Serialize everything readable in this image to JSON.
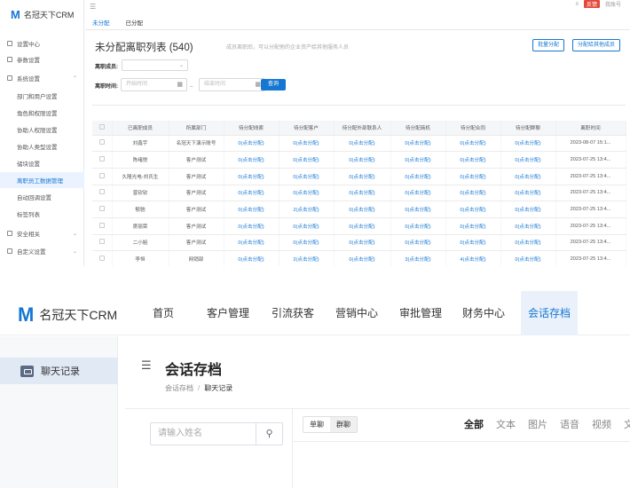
{
  "top": {
    "brand": "名冠天下CRM",
    "sidebar": [
      {
        "label": "设置中心",
        "icon": "settings-icon"
      },
      {
        "label": "参数设置",
        "icon": "params-icon"
      },
      {
        "label": "系统设置",
        "icon": "system-icon"
      },
      {
        "label": "部门和用户设置",
        "sub": true
      },
      {
        "label": "角色和权限设置",
        "sub": true
      },
      {
        "label": "协助人权限设置",
        "sub": true
      },
      {
        "label": "协助人类型设置",
        "sub": true
      },
      {
        "label": "储块设置",
        "sub": true
      },
      {
        "label": "离职员工数据管理",
        "sub": true,
        "active": true
      },
      {
        "label": "自动回调设置",
        "sub": true
      },
      {
        "label": "标签列表",
        "sub": true
      },
      {
        "label": "安全相关",
        "icon": "lock-icon"
      },
      {
        "label": "自定义设置",
        "icon": "custom-icon"
      }
    ],
    "header_badge": "反馈",
    "header_user": "我账号",
    "tabs": [
      "未分配",
      "已分配"
    ],
    "page_title": "未分配离职列表 (540)",
    "page_note": "成员离职后，可以分配他的企业资产给其他服务人员",
    "buttons": [
      "批量分配",
      "分配给其他成员"
    ],
    "filter_member_label": "离职成员:",
    "filter_time_label": "离职时间:",
    "date_start_placeholder": "开始时间",
    "date_end_placeholder": "结束时间",
    "date_separator": "_",
    "query_button": "查询",
    "columns": [
      "已离职成员",
      "所属部门",
      "待分配线索",
      "待分配客户",
      "待分配外部联系人",
      "待分配商机",
      "待分配合同",
      "待分配群聊",
      "离职时间"
    ],
    "rows": [
      [
        "刘鑫宇",
        "名冠天下演示账号",
        "0(点击分配)",
        "0(点击分配)",
        "0(点击分配)",
        "0(点击分配)",
        "0(点击分配)",
        "0(点击分配)",
        "2023-08-07 15:1..."
      ],
      [
        "陈绪悦",
        "客户测试",
        "0(点击分配)",
        "0(点击分配)",
        "0(点击分配)",
        "0(点击分配)",
        "0(点击分配)",
        "0(点击分配)",
        "2023-07-25 13:4..."
      ],
      [
        "久隆光电-刘氏生",
        "客户测试",
        "0(点击分配)",
        "0(点击分配)",
        "0(点击分配)",
        "0(点击分配)",
        "0(点击分配)",
        "0(点击分配)",
        "2023-07-25 13:4..."
      ],
      [
        "曾钦钦",
        "客户测试",
        "0(点击分配)",
        "0(点击分配)",
        "0(点击分配)",
        "0(点击分配)",
        "0(点击分配)",
        "0(点击分配)",
        "2023-07-25 13:4..."
      ],
      [
        "郁驰",
        "客户测试",
        "0(点击分配)",
        "2(点击分配)",
        "0(点击分配)",
        "0(点击分配)",
        "0(点击分配)",
        "0(点击分配)",
        "2023-07-25 13:4..."
      ],
      [
        "席丽荣",
        "客户测试",
        "0(点击分配)",
        "0(点击分配)",
        "0(点击分配)",
        "0(点击分配)",
        "0(点击分配)",
        "0(点击分配)",
        "2023-07-25 13:4..."
      ],
      [
        "二小姐",
        "客户测试",
        "0(点击分配)",
        "0(点击分配)",
        "0(点击分配)",
        "0(点击分配)",
        "0(点击分配)",
        "0(点击分配)",
        "2023-07-25 13:4..."
      ],
      [
        "李恒",
        "网销部",
        "0(点击分配)",
        "2(点击分配)",
        "0(点击分配)",
        "3(点击分配)",
        "4(点击分配)",
        "0(点击分配)",
        "2023-07-25 13:4..."
      ]
    ]
  },
  "bottom": {
    "brand": "名冠天下CRM",
    "nav": [
      "首页",
      "客户管理",
      "引流获客",
      "营销中心",
      "审批管理",
      "财务中心",
      "会话存档"
    ],
    "active_nav": "会话存档",
    "side_item": "聊天记录",
    "title": "会话存档",
    "breadcrumb": [
      "会话存档",
      "聊天记录"
    ],
    "search_placeholder": "请输入姓名",
    "segments": [
      "单聊",
      "群聊"
    ],
    "filter_tabs": [
      "全部",
      "文本",
      "图片",
      "语音",
      "视频",
      "文"
    ]
  }
}
